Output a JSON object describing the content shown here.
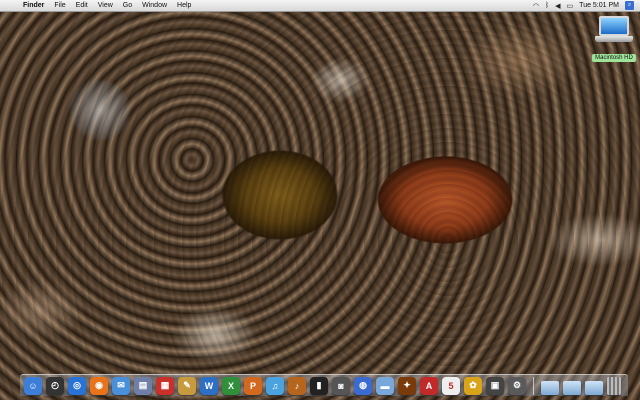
{
  "menubar": {
    "apple": "",
    "items": [
      "Finder",
      "File",
      "Edit",
      "View",
      "Go",
      "Window",
      "Help"
    ],
    "clock": "Tue 5:01 PM",
    "status_icons": [
      "wifi-icon",
      "bluetooth-icon",
      "volume-icon",
      "battery-icon"
    ]
  },
  "desktop_icon": {
    "label": "Macintosh HD"
  },
  "dock": {
    "apps": [
      {
        "name": "finder-icon",
        "glyph": "☺",
        "color": "#3d7fd8"
      },
      {
        "name": "dashboard-icon",
        "glyph": "◴",
        "color": "#333333"
      },
      {
        "name": "safari-icon",
        "glyph": "◎",
        "color": "#2a73d6"
      },
      {
        "name": "firefox-icon",
        "glyph": "◉",
        "color": "#e8731a"
      },
      {
        "name": "mail-icon",
        "glyph": "✉",
        "color": "#4a8fd9"
      },
      {
        "name": "preview-icon",
        "glyph": "▤",
        "color": "#6f7fa8"
      },
      {
        "name": "calendar-icon",
        "glyph": "▦",
        "color": "#c9302c"
      },
      {
        "name": "tools-icon",
        "glyph": "✎",
        "color": "#c79a3e"
      },
      {
        "name": "word-icon",
        "glyph": "W",
        "color": "#2e6fc6"
      },
      {
        "name": "excel-icon",
        "glyph": "X",
        "color": "#2f8f3a"
      },
      {
        "name": "powerpoint-icon",
        "glyph": "P",
        "color": "#d2691e"
      },
      {
        "name": "itunes-icon",
        "glyph": "♫",
        "color": "#4aa3df"
      },
      {
        "name": "guitar-icon",
        "glyph": "♪",
        "color": "#b5651d"
      },
      {
        "name": "terminal-icon",
        "glyph": "▮",
        "color": "#222222"
      },
      {
        "name": "photo-booth-icon",
        "glyph": "◙",
        "color": "#555555"
      },
      {
        "name": "network-icon",
        "glyph": "◍",
        "color": "#3b6bd0"
      },
      {
        "name": "widget-icon",
        "glyph": "▬",
        "color": "#7aa7d9"
      },
      {
        "name": "game-icon",
        "glyph": "✦",
        "color": "#7a3a0a"
      },
      {
        "name": "acrobat-icon",
        "glyph": "A",
        "color": "#c22a2a"
      },
      {
        "name": "calendar-5-icon",
        "glyph": "5",
        "color": "#eeeeee"
      },
      {
        "name": "flower-icon",
        "glyph": "✿",
        "color": "#d9a31a"
      },
      {
        "name": "photo-icon",
        "glyph": "▣",
        "color": "#444444"
      },
      {
        "name": "system-preferences-icon",
        "glyph": "⚙",
        "color": "#5a5a5a"
      }
    ],
    "folders": [
      "applications-folder-icon",
      "documents-folder-icon",
      "downloads-folder-icon"
    ]
  }
}
